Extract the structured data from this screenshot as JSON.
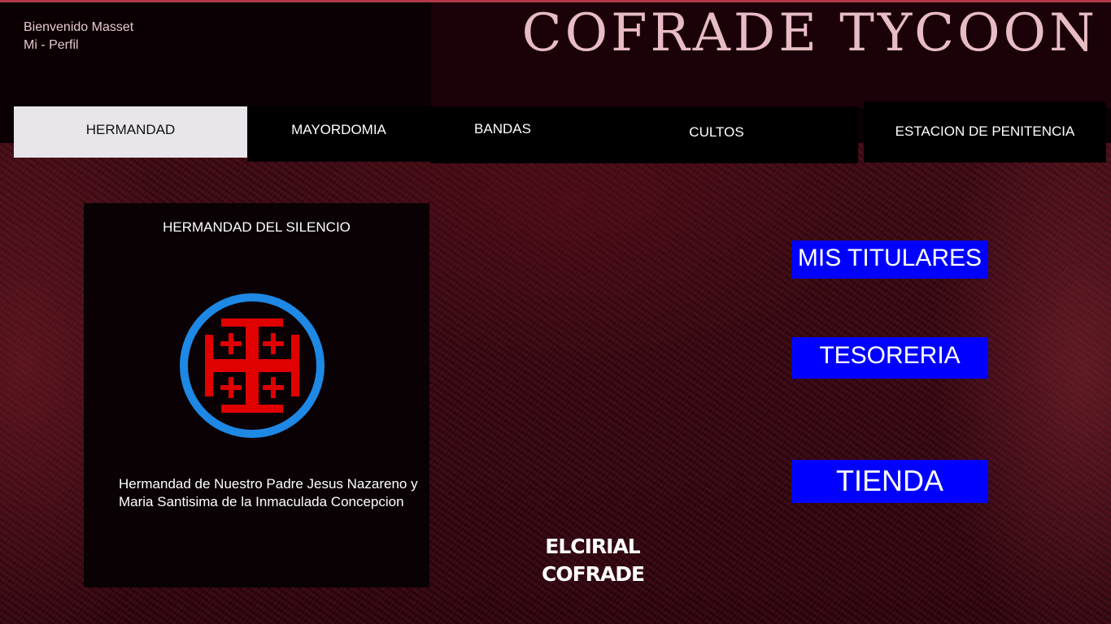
{
  "header": {
    "welcome": "Bienvenido Masset",
    "profile_link": "Mi - Perfil",
    "brand": "COFRADE  TYCOON"
  },
  "tabs": [
    {
      "label": "HERMANDAD",
      "active": true
    },
    {
      "label": "MAYORDOMIA",
      "active": false
    },
    {
      "label": "BANDAS",
      "active": false
    },
    {
      "label": "CULTOS",
      "active": false
    },
    {
      "label": "ESTACION DE PENITENCIA",
      "active": false
    }
  ],
  "card": {
    "title": "HERMANDAD DEL SILENCIO",
    "emblem_icon": "jerusalem-cross-icon",
    "description": "Hermandad de Nuestro Padre Jesus Nazareno y Maria Santisima de la Inmaculada Concepcion"
  },
  "actions": {
    "titulares": "MIS TITULARES",
    "tesoreria": "TESORERIA",
    "tienda": "TIENDA"
  },
  "logo": {
    "line1": "ELCIRIAL",
    "line2": "COFRADE"
  },
  "colors": {
    "accent_button": "#0000ff",
    "brand_text": "#e8bcc4",
    "emblem_ring": "#1e88e5",
    "emblem_cross": "#e00000"
  }
}
